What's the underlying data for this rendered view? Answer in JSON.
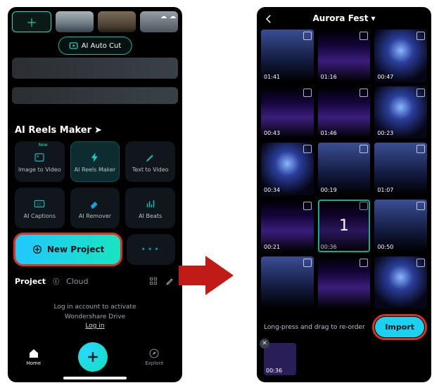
{
  "left": {
    "pill_label": "AI Auto Cut",
    "reels_header": "AI Reels Maker",
    "tools": [
      {
        "label": "Image to Video",
        "new": "New"
      },
      {
        "label": "AI Reels Maker"
      },
      {
        "label": "Text  to Video"
      },
      {
        "label": "AI Captions"
      },
      {
        "label": "AI Remover"
      },
      {
        "label": "AI Beats"
      }
    ],
    "new_project": "New Project",
    "more": "•••",
    "tabs": {
      "project": "Project",
      "cloud": "Cloud"
    },
    "login": {
      "line1": "Log in account to activate",
      "line2": "Wondershare Drive",
      "link": "Log in"
    },
    "nav": {
      "home": "Home",
      "explore": "Explore"
    }
  },
  "right": {
    "album": "Aurora Fest",
    "clips": [
      {
        "dur": "01:41"
      },
      {
        "dur": "01:16"
      },
      {
        "dur": "00:47"
      },
      {
        "dur": "00:43"
      },
      {
        "dur": "01:46"
      },
      {
        "dur": "00:23"
      },
      {
        "dur": "00:34"
      },
      {
        "dur": "00:19"
      },
      {
        "dur": "01:07"
      },
      {
        "dur": "00:21"
      },
      {
        "dur": "00:36",
        "selected": true,
        "num": "1"
      },
      {
        "dur": "00:50"
      },
      {
        "dur": ""
      },
      {
        "dur": ""
      },
      {
        "dur": ""
      }
    ],
    "hint": "Long-press and drag to re-order",
    "import": "Import",
    "tray_dur": "00:36"
  }
}
